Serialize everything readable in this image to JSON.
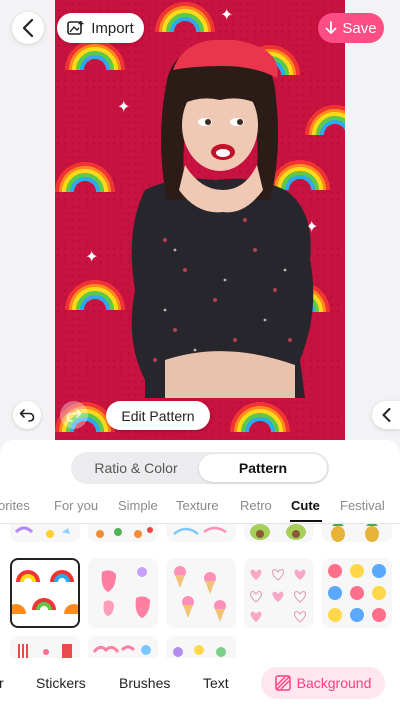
{
  "top_bar": {
    "import_label": "Import",
    "save_label": "Save"
  },
  "canvas": {
    "edit_pattern_label": "Edit Pattern",
    "background_color": "#c8123f"
  },
  "segmented": {
    "options": [
      "Ratio & Color",
      "Pattern"
    ],
    "selected": "Pattern"
  },
  "categories": {
    "items": [
      "orites",
      "For you",
      "Simple",
      "Texture",
      "Retro",
      "Cute",
      "Festival"
    ],
    "selected": "Cute"
  },
  "bottom_tabs": {
    "items": [
      "r",
      "Stickers",
      "Brushes",
      "Text"
    ],
    "active_label": "Background"
  },
  "colors": {
    "accent": "#ff4d85",
    "accent_soft": "#ffe6ef",
    "active_pill_text": "#ff3d7f"
  },
  "icons": {
    "back": "chevron-left-icon",
    "import": "image-add-icon",
    "save": "download-arrow-icon",
    "undo": "undo-icon",
    "redo": "redo-icon",
    "side": "chevron-left-icon",
    "background": "background-hatch-icon"
  }
}
